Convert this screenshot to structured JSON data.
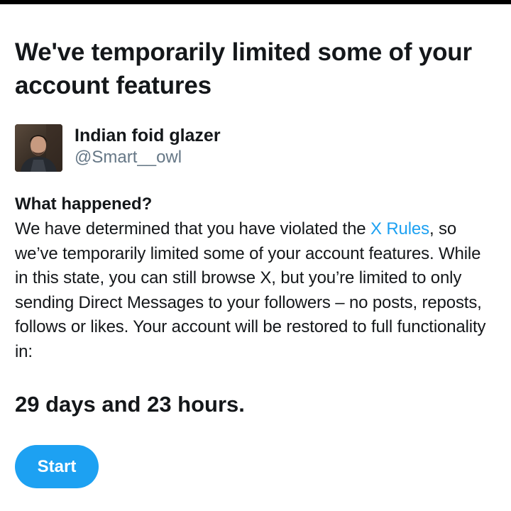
{
  "page": {
    "title": "We've temporarily limited some of your account features"
  },
  "account": {
    "display_name": "Indian foid glazer",
    "handle": "@Smart__owl",
    "avatar_icon": "profile-photo"
  },
  "notice": {
    "heading": "What happened?",
    "text_before_link": "We have determined that you have violated the ",
    "link_label": "X Rules",
    "text_after_link": ", so we’ve temporarily limited some of your account features. While in this state, you can still browse X, but you’re limited to only sending Direct Messages to your followers – no posts, reposts, follows or likes. Your account will be restored to full functionality in:"
  },
  "countdown": {
    "label": "29 days and 23 hours."
  },
  "actions": {
    "start_label": "Start"
  },
  "colors": {
    "accent": "#1da1f2",
    "text": "#14171a",
    "secondary_text": "#657786",
    "top_bar": "#000000"
  }
}
